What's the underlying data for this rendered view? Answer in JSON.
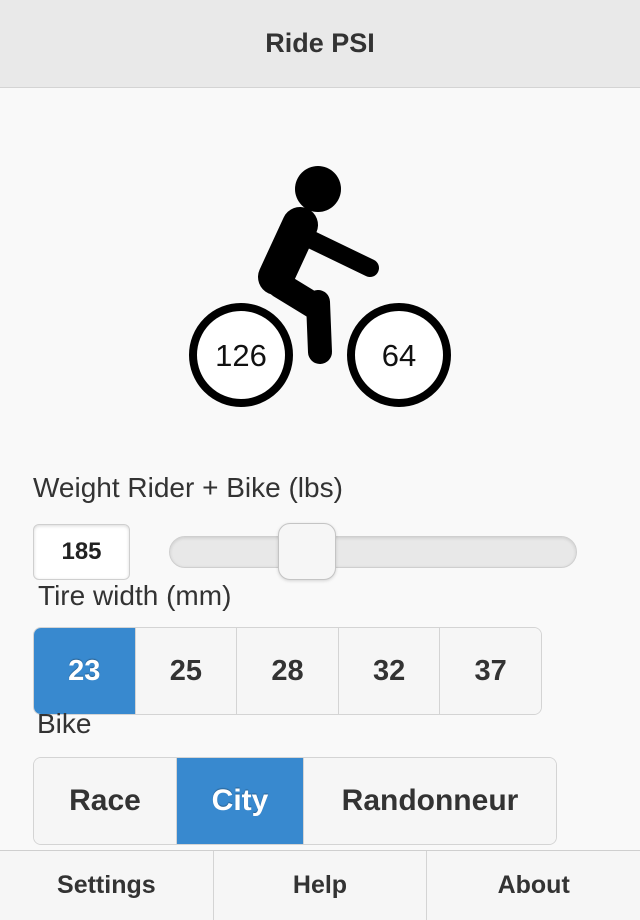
{
  "header": {
    "title": "Ride PSI"
  },
  "pressures": {
    "rear": "126",
    "front": "64"
  },
  "weight": {
    "label": "Weight Rider + Bike (lbs)",
    "value": "185",
    "slider_position": 0.41
  },
  "tire_width": {
    "label": "Tire width (mm)",
    "options": [
      "23",
      "25",
      "28",
      "32",
      "37"
    ],
    "selected": "23"
  },
  "bike": {
    "label": "Bike",
    "options": [
      "Race",
      "City",
      "Randonneur"
    ],
    "selected": "City"
  },
  "footer": {
    "tabs": [
      "Settings",
      "Help",
      "About"
    ]
  },
  "colors": {
    "accent": "#3889cf",
    "header_bg": "#e9e9e9",
    "background": "#f9f9f9",
    "icon": "#000000"
  },
  "icons": {
    "illustration": "cyclist-icon"
  }
}
